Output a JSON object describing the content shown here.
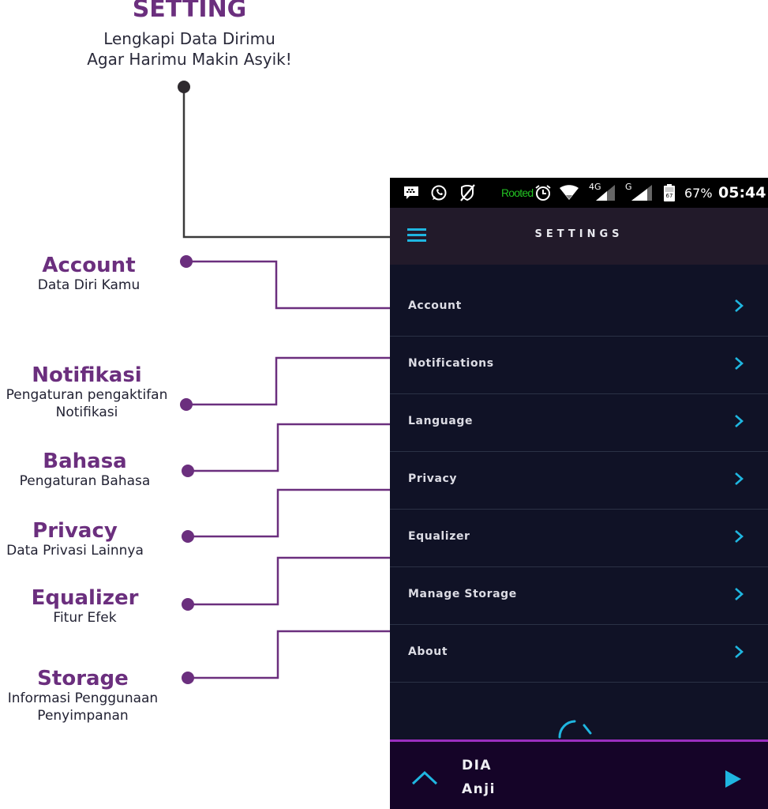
{
  "header": {
    "title": "SETTING",
    "subtitle_line1": "Lengkapi Data Dirimu",
    "subtitle_line2": "Agar Harimu Makin Asyik!"
  },
  "callouts": [
    {
      "title": "Account",
      "desc_line1": "Data Diri Kamu",
      "desc_line2": ""
    },
    {
      "title": "Notifikasi",
      "desc_line1": "Pengaturan pengaktifan",
      "desc_line2": "Notifikasi"
    },
    {
      "title": "Bahasa",
      "desc_line1": "Pengaturan Bahasa",
      "desc_line2": ""
    },
    {
      "title": "Privacy",
      "desc_line1": "Data Privasi Lainnya",
      "desc_line2": ""
    },
    {
      "title": "Equalizer",
      "desc_line1": "Fitur Efek",
      "desc_line2": ""
    },
    {
      "title": "Storage",
      "desc_line1": "Informasi Penggunaan",
      "desc_line2": "Penyimpanan"
    }
  ],
  "colors": {
    "callout_accent": "#6b2f7e",
    "header_connector": "#333333",
    "app_accent": "#1fb6e0",
    "player_border": "#9b2fc0",
    "rooted_text": "#22c022"
  },
  "statusbar": {
    "icons": [
      "bbm-icon",
      "whatsapp-icon",
      "blocked-icon"
    ],
    "rooted_label": "Rooted",
    "network_4g": "4G",
    "network_g": "G",
    "battery_level": "67",
    "battery_percent": "67%",
    "time": "05:44"
  },
  "appbar": {
    "title": "SETTINGS",
    "menu_icon": "hamburger-menu-icon"
  },
  "settings_items": [
    {
      "label": "Account"
    },
    {
      "label": "Notifications"
    },
    {
      "label": "Language"
    },
    {
      "label": "Privacy"
    },
    {
      "label": "Equalizer"
    },
    {
      "label": "Manage Storage"
    },
    {
      "label": "About"
    }
  ],
  "player": {
    "title": "DIA",
    "artist": "Anji",
    "expand_icon": "chevron-up-icon",
    "play_icon": "play-icon"
  }
}
